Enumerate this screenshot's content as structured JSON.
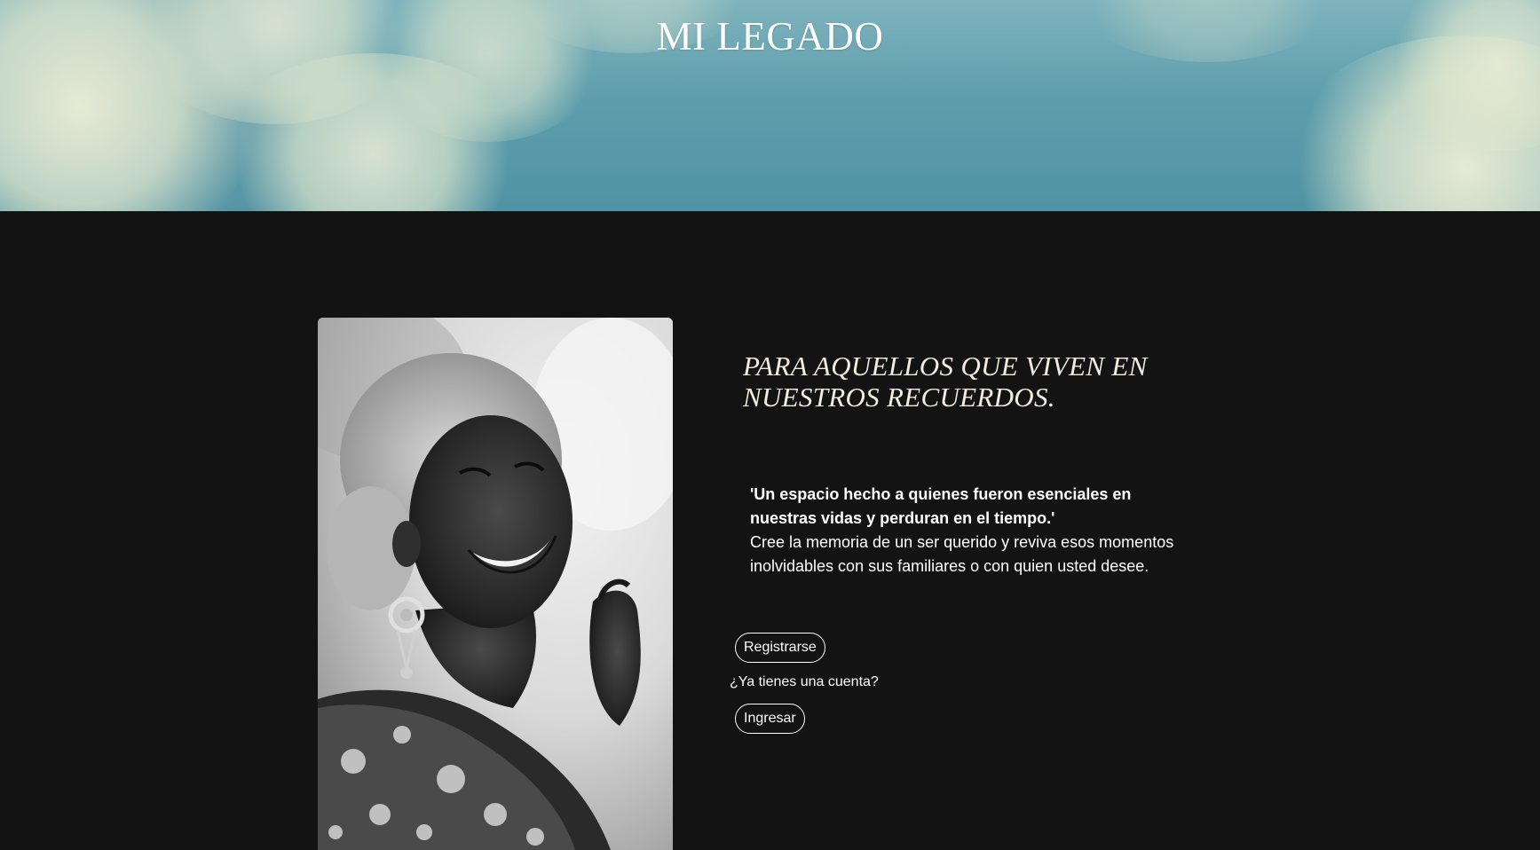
{
  "site": {
    "title": "MI LEGADO"
  },
  "hero_section": {
    "heading": "PARA AQUELLOS QUE VIVEN EN NUESTROS RECUERDOS.",
    "quote": "'Un espacio hecho a quienes fueron esenciales en nuestras vidas y perduran en el tiempo.'",
    "description": "Cree la memoria de un ser querido y reviva esos momentos inolvidables con sus familiares o con quien usted desee."
  },
  "actions": {
    "register_label": "Registrarse",
    "account_question": "¿Ya tienes una cuenta?",
    "login_label": "Ingresar"
  },
  "colors": {
    "page_background": "#131313",
    "sky": "#5f9fad",
    "heading_text": "#f3ede0",
    "text": "#ffffff"
  }
}
